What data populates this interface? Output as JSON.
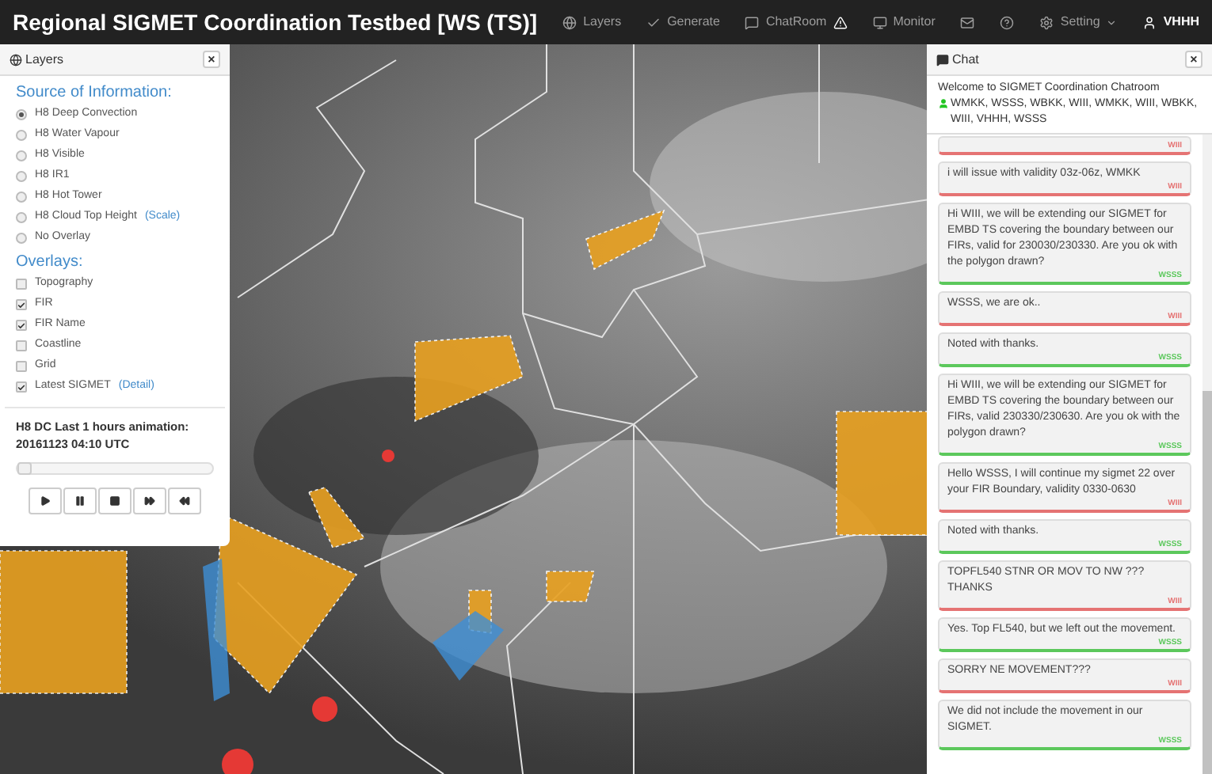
{
  "navbar": {
    "title": "Regional SIGMET Coordination Testbed [WS (TS)]",
    "items": [
      {
        "label": "Layers"
      },
      {
        "label": "Generate"
      },
      {
        "label": "ChatRoom"
      },
      {
        "label": "Monitor"
      }
    ],
    "right": [
      {
        "label": "Setting"
      },
      {
        "label": "VHHH"
      }
    ]
  },
  "layers_panel": {
    "title": "Layers",
    "close": "×",
    "source_heading": "Source of Information:",
    "sources": [
      {
        "label": "H8 Deep Convection",
        "selected": true
      },
      {
        "label": "H8 Water Vapour",
        "selected": false
      },
      {
        "label": "H8 Visible",
        "selected": false
      },
      {
        "label": "H8 IR1",
        "selected": false
      },
      {
        "label": "H8 Hot Tower",
        "selected": false
      },
      {
        "label": "H8 Cloud Top Height",
        "link": "(Scale)",
        "selected": false
      },
      {
        "label": "No Overlay",
        "selected": false
      }
    ],
    "overlays_heading": "Overlays:",
    "overlays": [
      {
        "label": "Topography",
        "checked": false
      },
      {
        "label": "FIR",
        "checked": true
      },
      {
        "label": "FIR Name",
        "checked": true
      },
      {
        "label": "Coastline",
        "checked": false
      },
      {
        "label": "Grid",
        "checked": false
      },
      {
        "label": "Latest SIGMET",
        "link": "(Detail)",
        "checked": true
      }
    ],
    "animation_title": "H8 DC Last 1 hours animation:",
    "animation_time": "20161123 04:10 UTC",
    "animation_slider": {
      "level": 0
    }
  },
  "chat_panel": {
    "title": "Chat",
    "close": "×",
    "welcome": "Welcome to SIGMET Coordination Chatroom",
    "users": "WMKK, WSSS, WBKK, WIII, WMKK, WIII, WBKK, WIII, VHHH, WSSS",
    "messages": [
      {
        "sender": "WIII",
        "color": "#e57373"
      },
      {
        "text": "i will issue with validity 03z-06z, WMKK",
        "sender": "WIII",
        "color": "#e57373"
      },
      {
        "text": "Hi WIII, we will be extending our SIGMET for EMBD TS covering the boundary between our FIRs, valid for 230030/230330. Are you ok with the polygon drawn?",
        "sender": "WSSS",
        "color": "#5cc85c"
      },
      {
        "text": "WSSS, we are ok..",
        "sender": "WIII",
        "color": "#e57373"
      },
      {
        "text": "Noted with thanks.",
        "sender": "WSSS",
        "color": "#5cc85c"
      },
      {
        "text": "Hi WIII, we will be extending our SIGMET for EMBD TS covering the boundary between our FIRs, valid 230330/230630. Are you ok with the polygon drawn?",
        "sender": "WSSS",
        "color": "#5cc85c"
      },
      {
        "text": "Hello WSSS, I will continue my sigmet 22 over your FIR Boundary, validity 0330-0630",
        "sender": "WIII",
        "color": "#e57373"
      },
      {
        "text": "Noted with thanks.",
        "sender": "WSSS",
        "color": "#5cc85c"
      },
      {
        "text": "TOPFL540 STNR OR MOV TO NW ??? THANKS",
        "sender": "WIII",
        "color": "#e57373"
      },
      {
        "text": "Yes. Top FL540, but we left out the movement.",
        "sender": "WSSS",
        "color": "#5cc85c"
      },
      {
        "text": "SORRY NE MOVEMENT???",
        "sender": "WIII",
        "color": "#e57373"
      },
      {
        "text": "We did not include the movement in our SIGMET.",
        "sender": "WSSS",
        "color": "#5cc85c"
      }
    ]
  }
}
